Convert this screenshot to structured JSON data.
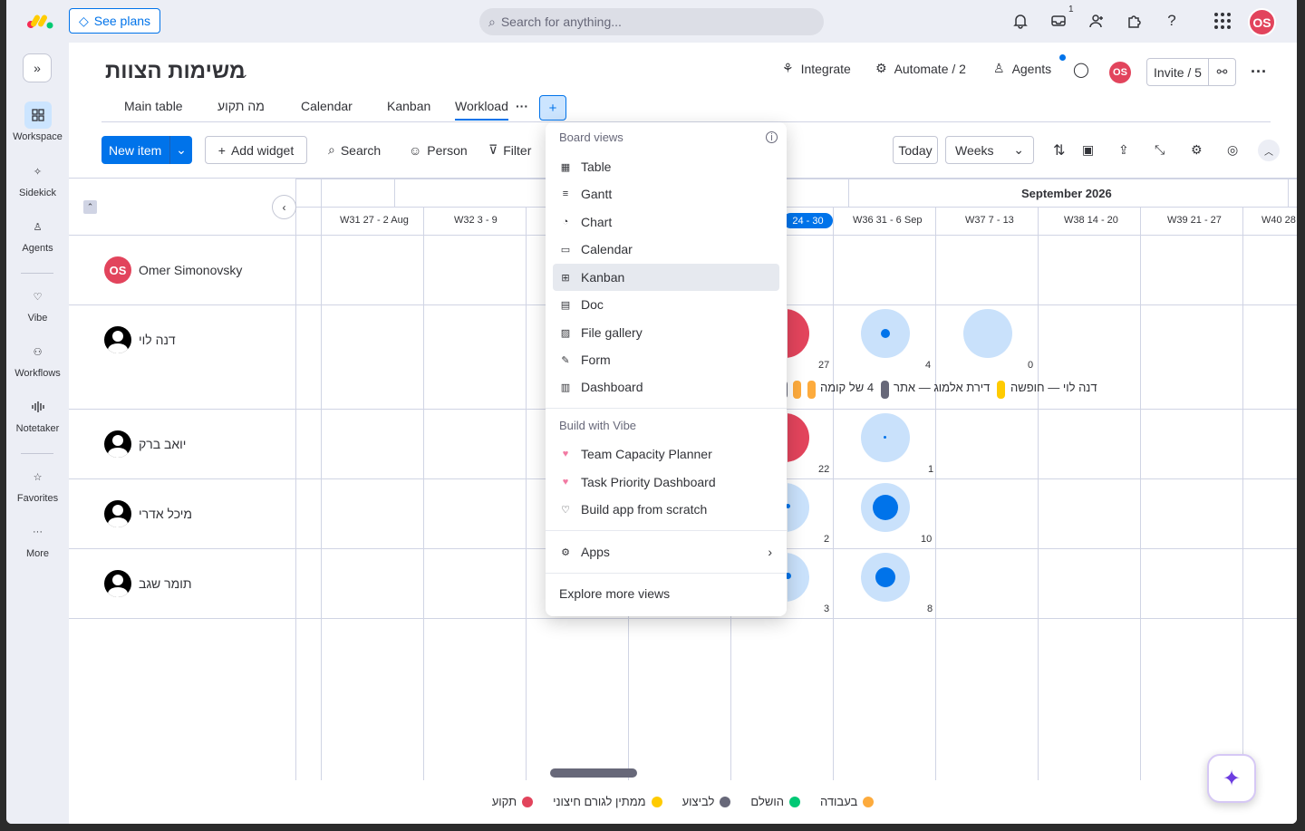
{
  "topbar": {
    "see_plans": "See plans",
    "search_placeholder": "Search for anything...",
    "inbox_badge": "1",
    "user_initials": "OS"
  },
  "leftnav": {
    "items": [
      {
        "label": "Workspace"
      },
      {
        "label": "Sidekick"
      },
      {
        "label": "Agents"
      },
      {
        "label": "Vibe"
      },
      {
        "label": "Workflows"
      },
      {
        "label": "Notetaker"
      },
      {
        "label": "Favorites"
      },
      {
        "label": "More"
      }
    ]
  },
  "board": {
    "title": "משימות הצוות",
    "integrate": "Integrate",
    "automate": "Automate / 2",
    "agents": "Agents",
    "avatar": "OS",
    "invite": "Invite / 5",
    "tabs": [
      "Main table",
      "מה תקוע",
      "Calendar",
      "Kanban",
      "Workload"
    ],
    "toolbar": {
      "new_item": "New item",
      "add_widget": "Add widget",
      "search": "Search",
      "person": "Person",
      "filter": "Filter",
      "today": "Today",
      "weeks": "Weeks"
    }
  },
  "timeline": {
    "month": "September 2026",
    "weeks": [
      "W31 27 - 2 Aug",
      "W32 3 - 9",
      "24 - 30",
      "W36 31 - 6 Sep",
      "W37 7 - 13",
      "W38 14 - 20",
      "W39 21 - 27",
      "W40 28"
    ],
    "people": [
      {
        "name": "Omer Simonovsky",
        "initials": "OS"
      },
      {
        "name": "דנה לוי"
      },
      {
        "name": "יואב ברק"
      },
      {
        "name": "מיכל אדרי"
      },
      {
        "name": "תומר שגב"
      }
    ],
    "counts": {
      "dana": [
        "27",
        "4",
        "0"
      ],
      "yoav": [
        "22",
        "1"
      ],
      "michal": [
        "2",
        "10"
      ],
      "tomer": [
        "3",
        "8"
      ]
    },
    "chips_text_1": "4 של קומה",
    "chips_text_2": "דירת אלמוג — אתר",
    "chips_text_3": "דנה לוי — חופשה"
  },
  "legend": [
    {
      "label": "בעבודה",
      "color": "#fdab3d"
    },
    {
      "label": "הושלם",
      "color": "#00c875"
    },
    {
      "label": "לביצוע",
      "color": "#676879"
    },
    {
      "label": "ממתין לגורם חיצוני",
      "color": "#ffcb00"
    },
    {
      "label": "תקוע",
      "color": "#e2445c"
    }
  ],
  "menu": {
    "board_views": "Board views",
    "views": [
      "Table",
      "Gantt",
      "Chart",
      "Calendar",
      "Kanban",
      "Doc",
      "File gallery",
      "Form",
      "Dashboard"
    ],
    "build_with_vibe": "Build with Vibe",
    "vibe_items": [
      "Team Capacity Planner",
      "Task Priority Dashboard",
      "Build app from scratch"
    ],
    "apps": "Apps",
    "explore": "Explore more views"
  }
}
